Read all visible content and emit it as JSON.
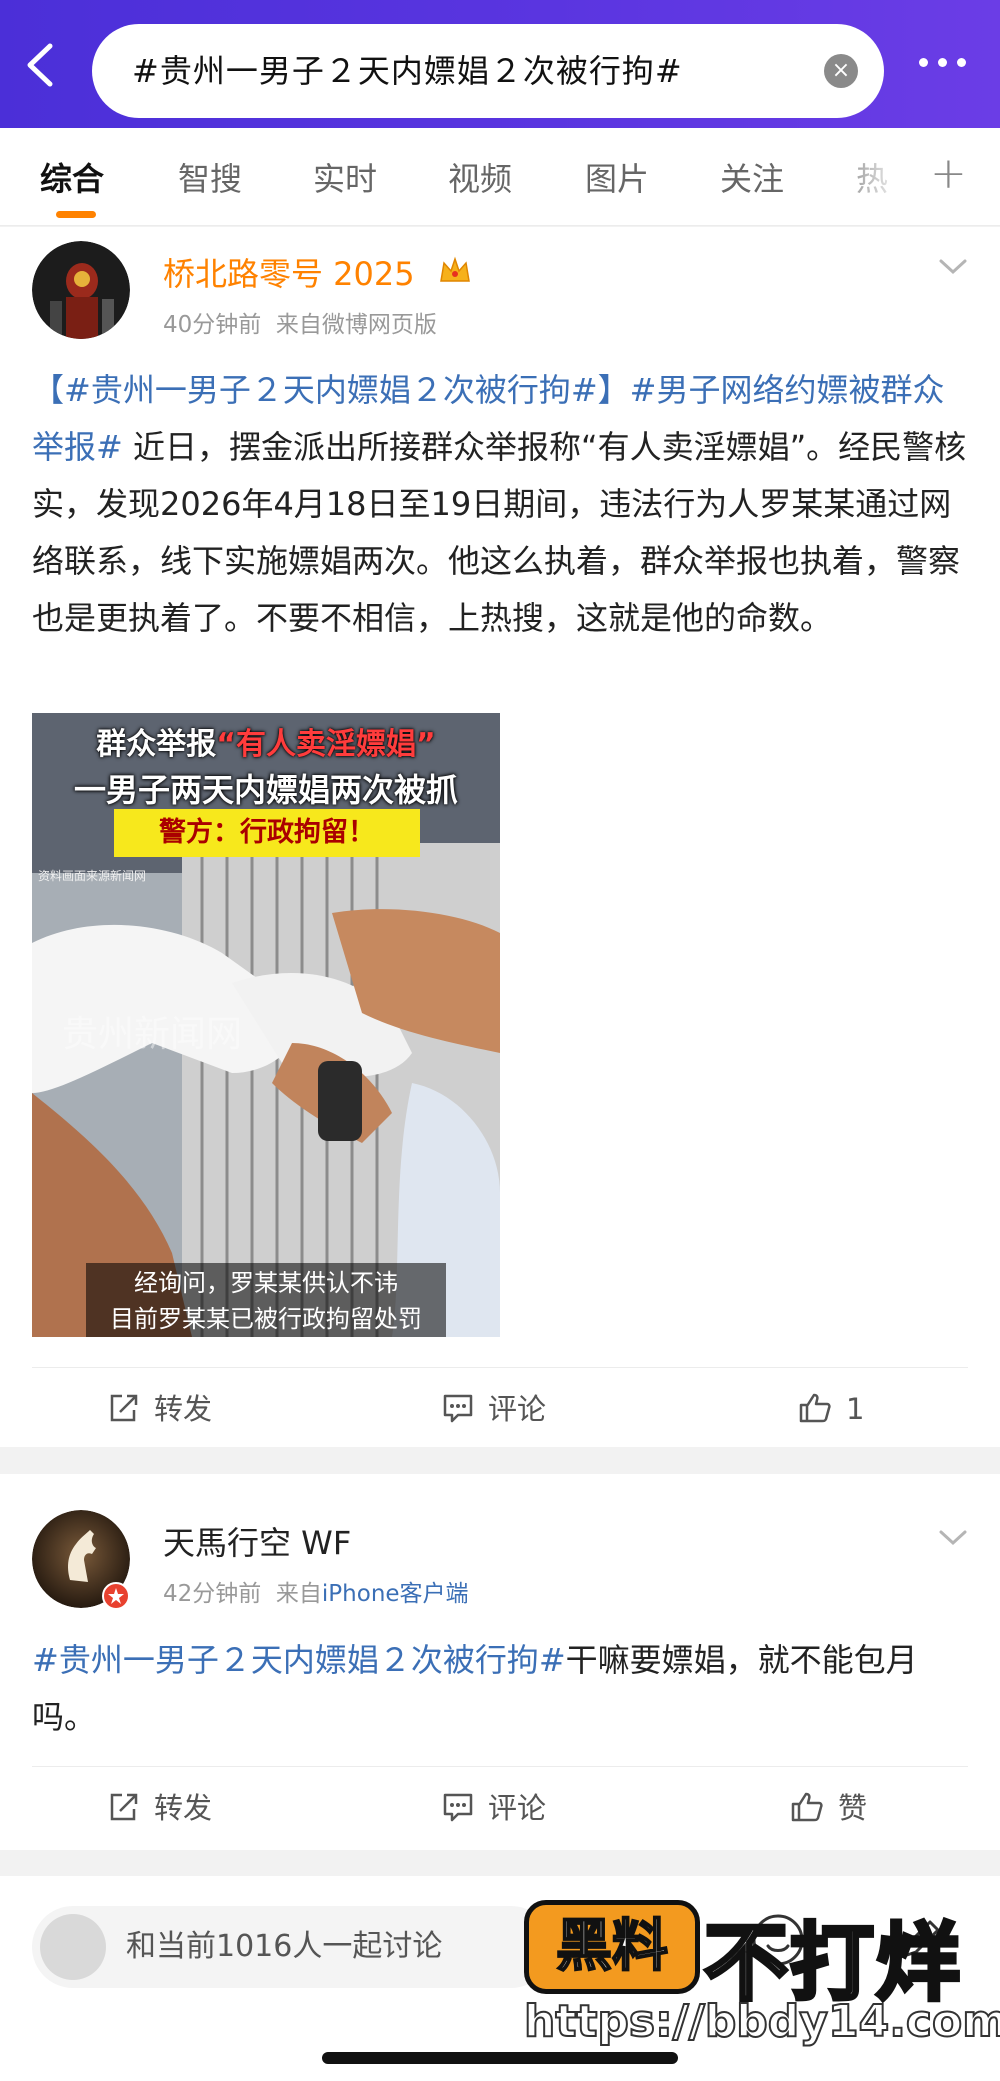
{
  "search": {
    "query": "#贵州一男子２天内嫖娼２次被行拘#"
  },
  "tabs": [
    "综合",
    "智搜",
    "实时",
    "视频",
    "图片",
    "关注",
    "热"
  ],
  "posts": [
    {
      "author": "桥北路零号 2025",
      "time": "40分钟前",
      "source": "来自微博网页版",
      "tag1": "【#贵州一男子２天内嫖娼２次被行拘#】",
      "tag2": "#男子网络约嫖被群众举报#",
      "text": " 近日，摆金派出所接群众举报称“有人卖淫嫖娼”。经民警核实，发现2026年4月18日至19日期间，违法行为人罗某某通过网络联系，线下实施嫖娼两次。他这么执着，群众举报也执着，警察也是更执着了。不要不相信，上热搜，这就是他的命数。",
      "image": {
        "cap1_a": "群众举报",
        "cap1_b": "“有人卖淫嫖娼”",
        "cap2": "一男子两天内嫖娼两次被抓",
        "cap3": "警方：行政拘留！",
        "watermark_small": "资料画面来源新闻网",
        "watermark": "贵州新闻网",
        "subtitle1": "经询问，罗某某供认不讳",
        "subtitle2": "目前罗某某已被行政拘留处罚"
      },
      "actions": {
        "repost": "转发",
        "comment": "评论",
        "like": "1"
      }
    },
    {
      "author": "天馬行空 WF",
      "time": "42分钟前",
      "source_prefix": "来自",
      "source_link": "iPhone客户端",
      "tag1": "#贵州一男子２天内嫖娼２次被行拘#",
      "text": "干嘛要嫖娼，就不能包月吗。",
      "actions": {
        "repost": "转发",
        "comment": "评论",
        "like": "赞"
      }
    }
  ],
  "bottom": {
    "discuss": "和当前1016人一起讨论"
  },
  "watermark": {
    "logo": "黑料",
    "name": "不打烊",
    "url": "https://bbdy14.com"
  },
  "colors": {
    "topbar": "#5a35e0",
    "accent": "#ff8200",
    "tag": "#3b6fb6",
    "author1": "#ff8200"
  }
}
